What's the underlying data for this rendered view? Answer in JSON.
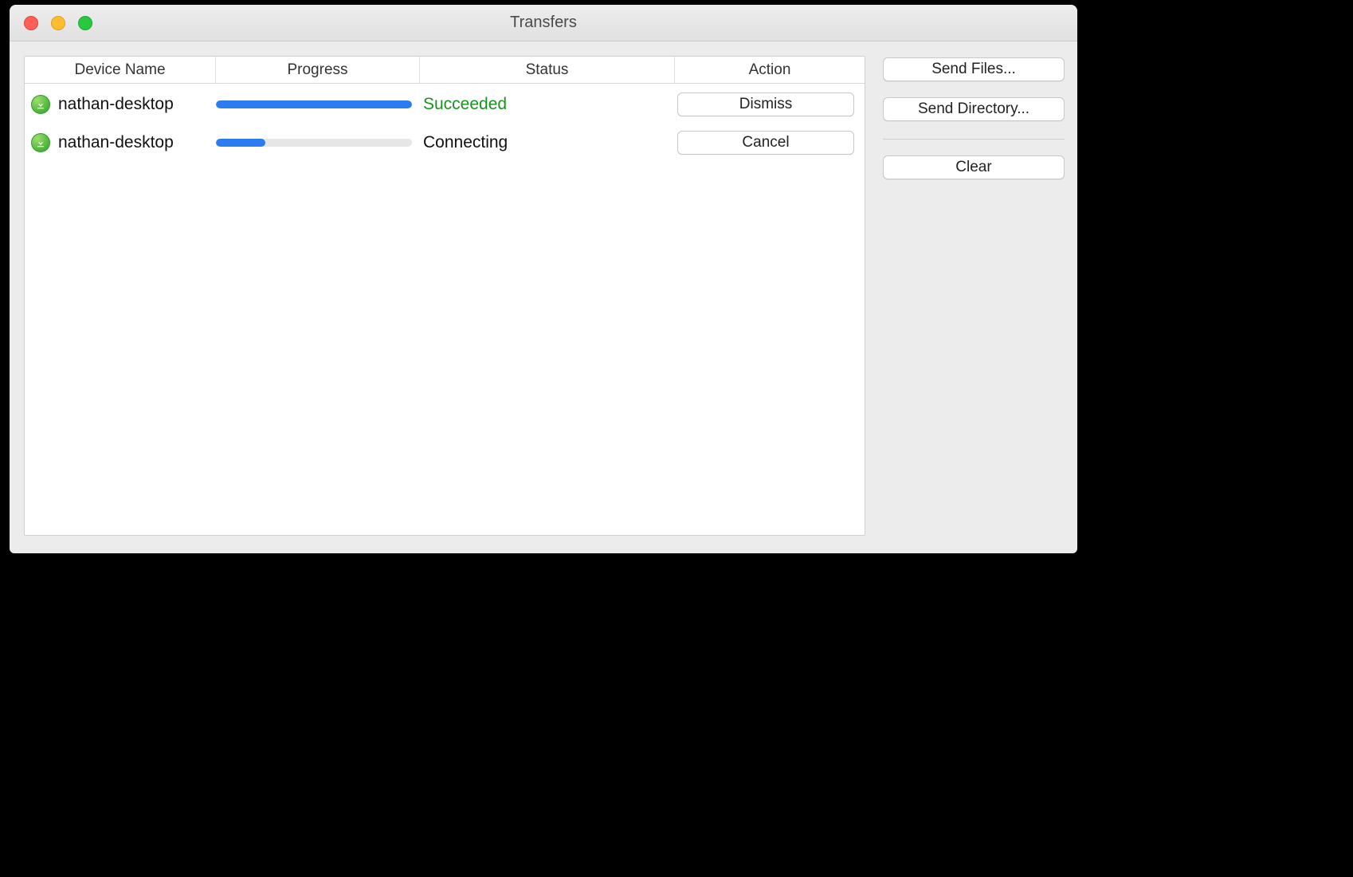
{
  "window": {
    "title": "Transfers"
  },
  "columns": {
    "device": "Device Name",
    "progress": "Progress",
    "status": "Status",
    "action": "Action"
  },
  "rows": [
    {
      "icon": "download-icon",
      "device": "nathan-desktop",
      "progress_percent": 100,
      "status": "Succeeded",
      "status_kind": "success",
      "action_label": "Dismiss"
    },
    {
      "icon": "download-icon",
      "device": "nathan-desktop",
      "progress_percent": 25,
      "status": "Connecting",
      "status_kind": "normal",
      "action_label": "Cancel"
    }
  ],
  "sidebar": {
    "send_files": "Send Files...",
    "send_directory": "Send Directory...",
    "clear": "Clear"
  },
  "colors": {
    "accent": "#2a7cf0",
    "success": "#18931f"
  }
}
